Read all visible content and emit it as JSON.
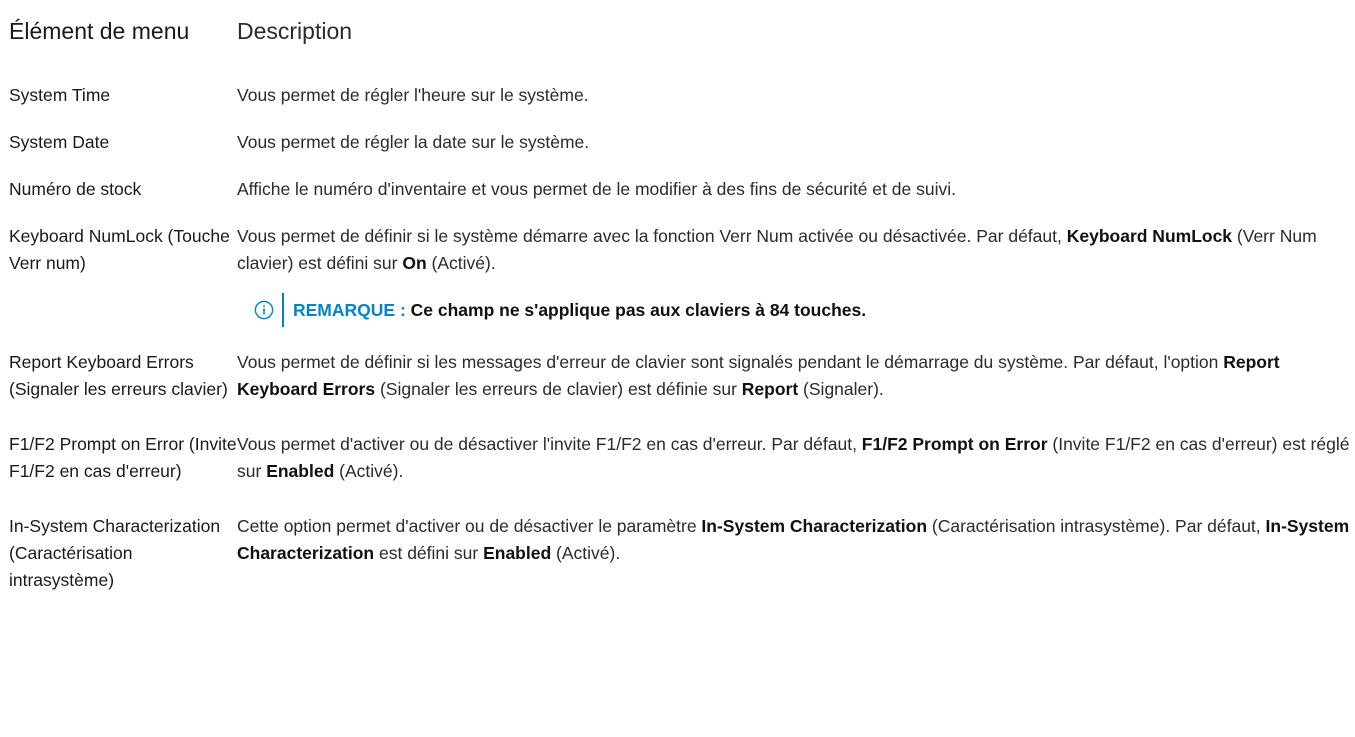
{
  "header": {
    "col1": "Élément de menu",
    "col2": "Description"
  },
  "rows": [
    {
      "item": "System Time",
      "desc": "Vous permet de régler l'heure sur le système."
    },
    {
      "item": "System Date",
      "desc": "Vous permet de régler la date sur le système."
    },
    {
      "item": "Numéro de stock",
      "desc": "Affiche le numéro d'inventaire et vous permet de le modifier à des fins de sécurité et de suivi."
    },
    {
      "item": "Keyboard NumLock (Touche Verr num)",
      "desc_a": "Vous permet de définir si le système démarre avec la fonction Verr Num activée ou désactivée. Par défaut, ",
      "desc_b": "Keyboard NumLock",
      "desc_c": " (Verr Num clavier) est défini sur ",
      "desc_d": "On",
      "desc_e": " (Activé).",
      "note_label": "REMARQUE : ",
      "note_text": "Ce champ ne s'applique pas aux claviers à 84 touches."
    },
    {
      "item": "Report Keyboard Errors (Signaler les erreurs clavier)",
      "desc_a": "Vous permet de définir si les messages d'erreur de clavier sont signalés pendant le démarrage du système. Par défaut, l'option ",
      "desc_b": "Report Keyboard Errors",
      "desc_c": " (Signaler les erreurs de clavier) est définie sur ",
      "desc_d": "Report",
      "desc_e": " (Signaler)."
    },
    {
      "item": "F1/F2 Prompt on Error (Invite F1/F2 en cas d'erreur)",
      "desc_a": "Vous permet d'activer ou de désactiver l'invite F1/F2 en cas d'erreur. Par défaut, ",
      "desc_b": "F1/F2 Prompt on Error",
      "desc_c": " (Invite F1/F2 en cas d'erreur) est réglé sur ",
      "desc_d": "Enabled",
      "desc_e": " (Activé)."
    },
    {
      "item": "In-System Characterization (Caractérisation intrasystème)",
      "desc_a": "Cette option permet d'activer ou de désactiver le paramètre ",
      "desc_b": "In-System Characterization",
      "desc_c": " (Caractérisation intrasystème). Par défaut, ",
      "desc_d": "In-System Characterization",
      "desc_e": " est défini sur ",
      "desc_f": "Enabled",
      "desc_g": " (Activé)."
    }
  ],
  "icons": {
    "note": "info-circle-icon"
  },
  "colors": {
    "accent": "#0085c3"
  }
}
